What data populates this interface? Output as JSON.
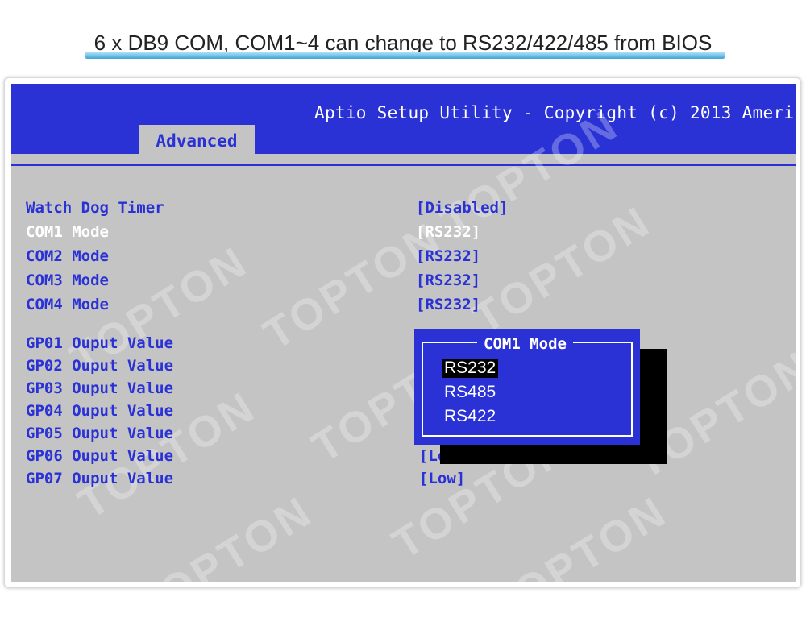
{
  "caption": "6 x DB9 COM, COM1~4 can change to RS232/422/485 from BIOS",
  "bios": {
    "header_title": "Aptio Setup Utility - Copyright (c) 2013 Ameri",
    "active_tab": "Advanced",
    "settings": [
      {
        "label": "Watch Dog Timer",
        "value": "[Disabled]"
      },
      {
        "label": "COM1 Mode",
        "value": "[RS232]",
        "selected": true
      },
      {
        "label": "COM2 Mode",
        "value": "[RS232]"
      },
      {
        "label": "COM3 Mode",
        "value": "[RS232]"
      },
      {
        "label": "COM4 Mode",
        "value": "[RS232]"
      }
    ],
    "gpio": [
      {
        "label": "GP01 Ouput Value"
      },
      {
        "label": "GP02 Ouput Value"
      },
      {
        "label": "GP03 Ouput Value"
      },
      {
        "label": "GP04 Ouput Value"
      },
      {
        "label": "GP05 Ouput Value"
      },
      {
        "label": "GP06 Ouput Value",
        "value": "[Lo"
      },
      {
        "label": "GP07 Ouput Value",
        "value": "[Low]"
      }
    ],
    "popup": {
      "title": "COM1 Mode",
      "options": [
        "RS232",
        "RS485",
        "RS422"
      ],
      "highlighted": "RS232"
    }
  },
  "watermark": "TOPTON",
  "colors": {
    "bios_blue": "#2a32d6",
    "bios_gray": "#c4c4c4",
    "selected_text": "#ffffff"
  }
}
